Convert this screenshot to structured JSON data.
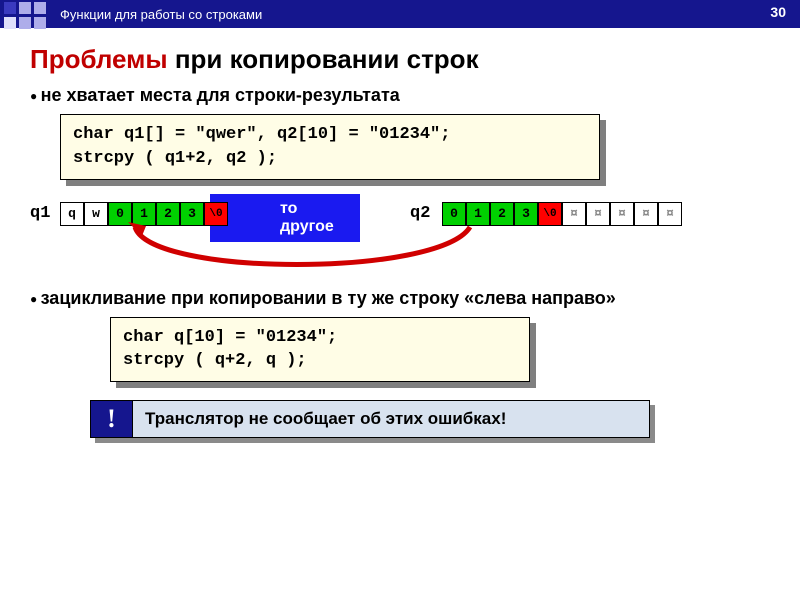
{
  "page_number": "30",
  "header": "Функции для работы со строками",
  "title_red": "Проблемы",
  "title_black": " при копировании строк",
  "bullet1": "не хватает места для строки-результата",
  "code1": "char q1[] = \"qwer\", q2[10] = \"01234\";\nstrcpy ( q1+2, q2 );",
  "q1_label": "q1",
  "q2_label": "q2",
  "blue_text": "то другое",
  "q1_cells": [
    {
      "v": "q",
      "c": ""
    },
    {
      "v": "w",
      "c": ""
    },
    {
      "v": "0",
      "c": "g"
    },
    {
      "v": "1",
      "c": "g"
    },
    {
      "v": "2",
      "c": "g"
    },
    {
      "v": "3",
      "c": "g"
    },
    {
      "v": "\\0",
      "c": "r"
    }
  ],
  "q2_cells": [
    {
      "v": "0",
      "c": "g"
    },
    {
      "v": "1",
      "c": "g"
    },
    {
      "v": "2",
      "c": "g"
    },
    {
      "v": "3",
      "c": "g"
    },
    {
      "v": "\\0",
      "c": "r"
    },
    {
      "v": "¤",
      "c": "x"
    },
    {
      "v": "¤",
      "c": "x"
    },
    {
      "v": "¤",
      "c": "x"
    },
    {
      "v": "¤",
      "c": "x"
    },
    {
      "v": "¤",
      "c": "x"
    }
  ],
  "bullet2": "зацикливание при копировании в ту же строку «слева направо»",
  "code2": "char q[10] = \"01234\";\nstrcpy ( q+2, q );",
  "note_icon": "!",
  "note_text": "Транслятор не сообщает об этих ошибках!"
}
